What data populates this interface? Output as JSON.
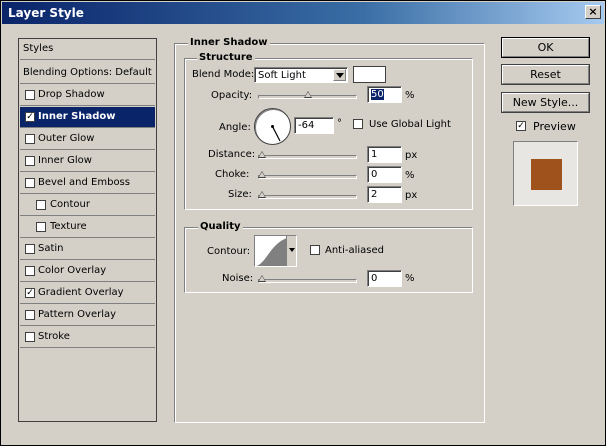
{
  "window": {
    "title": "Layer Style",
    "close": "×"
  },
  "styles_panel": {
    "header": "Styles",
    "items": [
      {
        "label": "Blending Options: Default",
        "checked": null
      },
      {
        "label": "Drop Shadow",
        "checked": ""
      },
      {
        "label": "Inner Shadow",
        "checked": "✓"
      },
      {
        "label": "Outer Glow",
        "checked": ""
      },
      {
        "label": "Inner Glow",
        "checked": ""
      },
      {
        "label": "Bevel and Emboss",
        "checked": ""
      },
      {
        "label": "Contour",
        "checked": ""
      },
      {
        "label": "Texture",
        "checked": ""
      },
      {
        "label": "Satin",
        "checked": ""
      },
      {
        "label": "Color Overlay",
        "checked": ""
      },
      {
        "label": "Gradient Overlay",
        "checked": "✓"
      },
      {
        "label": "Pattern Overlay",
        "checked": ""
      },
      {
        "label": "Stroke",
        "checked": ""
      }
    ]
  },
  "inner_shadow": {
    "section_title": "Inner Shadow",
    "structure_title": "Structure",
    "blend_mode_label": "Blend Mode:",
    "blend_mode_value": "Soft Light",
    "opacity_label": "Opacity:",
    "opacity_value": "50",
    "opacity_unit": "%",
    "angle_label": "Angle:",
    "angle_value": "-64",
    "angle_unit": "°",
    "use_global_light_label": "Use Global Light",
    "distance_label": "Distance:",
    "distance_value": "1",
    "distance_unit": "px",
    "choke_label": "Choke:",
    "choke_value": "0",
    "choke_unit": "%",
    "size_label": "Size:",
    "size_value": "2",
    "size_unit": "px",
    "quality_title": "Quality",
    "contour_label": "Contour:",
    "anti_aliased_label": "Anti-aliased",
    "noise_label": "Noise:",
    "noise_value": "0",
    "noise_unit": "%"
  },
  "sliders": {
    "opacity": 0.5,
    "distance": 0.0,
    "choke": 0.0,
    "size": 0.0,
    "noise": 0.0
  },
  "buttons": {
    "ok": "OK",
    "reset": "Reset",
    "new_style": "New Style...",
    "preview": "Preview",
    "preview_checked": "✓"
  },
  "colors": {
    "shadow_color": "#ffffff",
    "preview_swatch": "#a0521c",
    "title_bar": "#0a246a",
    "selection": "#0a246a"
  }
}
